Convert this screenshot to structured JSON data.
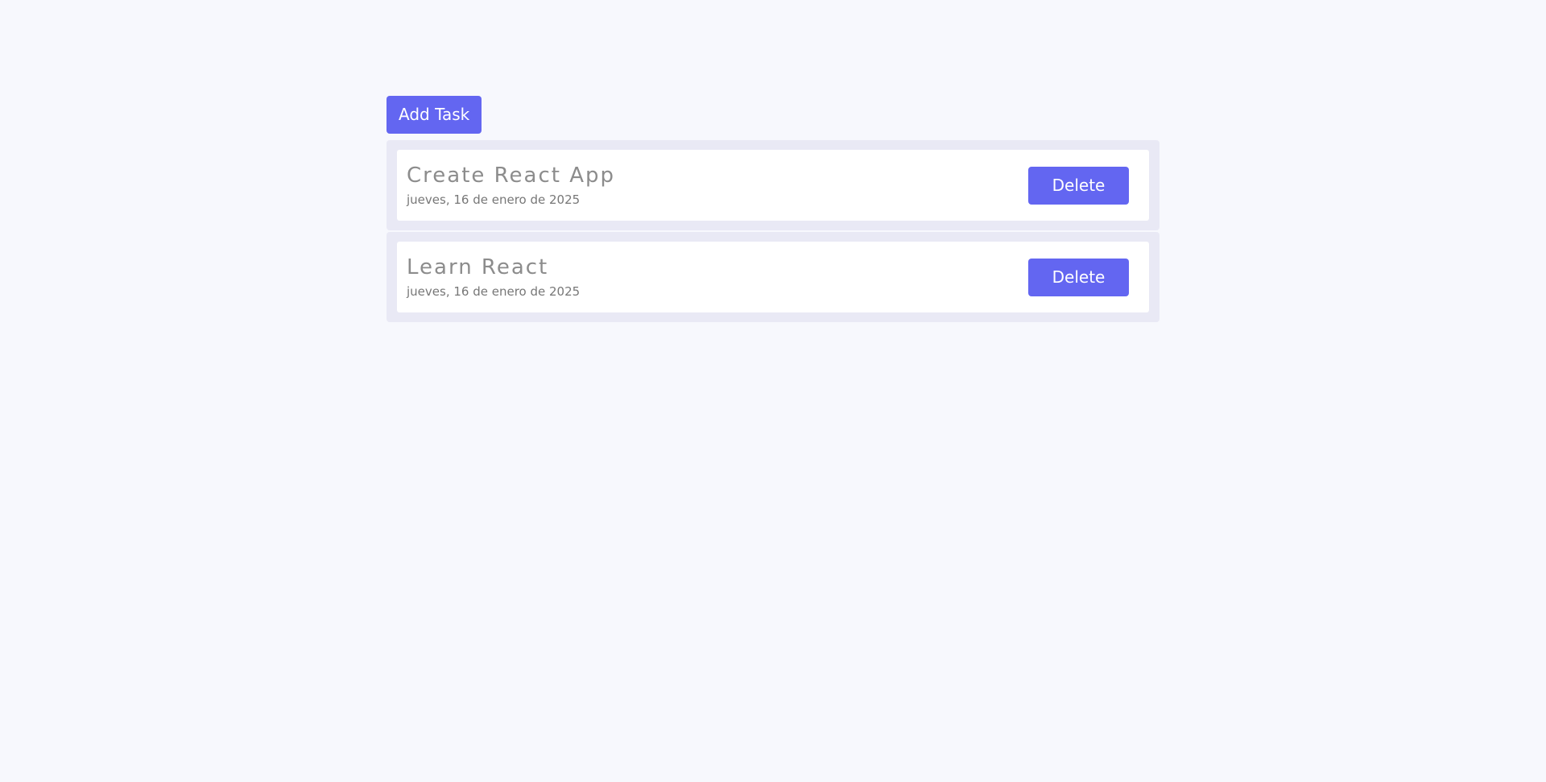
{
  "toolbar": {
    "add_label": "Add Task"
  },
  "tasks": [
    {
      "title": "Create React App",
      "date": "jueves, 16 de enero de 2025",
      "delete_label": "Delete"
    },
    {
      "title": "Learn React",
      "date": "jueves, 16 de enero de 2025",
      "delete_label": "Delete"
    }
  ],
  "colors": {
    "accent": "#6366f1",
    "background": "#f7f8fd",
    "card_wrap": "#e9e9f5",
    "card": "#ffffff"
  }
}
